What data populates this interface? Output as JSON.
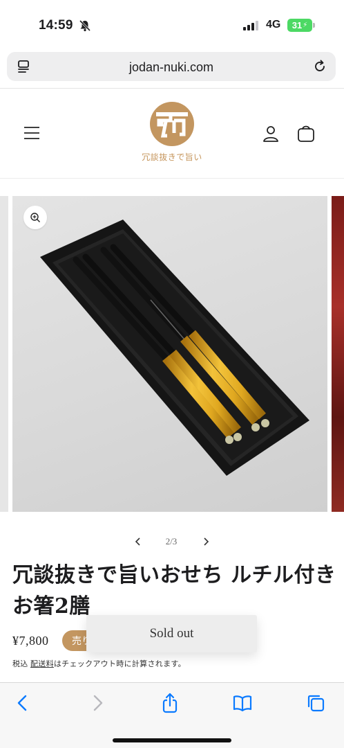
{
  "status_bar": {
    "time": "14:59",
    "network": "4G",
    "battery": "31"
  },
  "browser": {
    "url": "jodan-nuki.com"
  },
  "site": {
    "logo_text": "冗談抜きで旨い",
    "brand_color": "#c39660"
  },
  "gallery": {
    "counter": "2/3"
  },
  "product": {
    "title": "冗談抜きで旨いおせち ルチル付きお箸2膳",
    "price": "¥7,800",
    "badge": "売り",
    "sold_out_toast": "Sold out",
    "tax_prefix": "税込",
    "tax_link": "配送料",
    "tax_suffix": "はチェックアウト時に計算されます。"
  },
  "icons": {
    "menu": "hamburger-icon",
    "account": "person-icon",
    "cart": "bag-icon",
    "zoom": "zoom-in-icon",
    "back": "chevron-left-icon",
    "forward": "chevron-right-icon",
    "share": "share-icon",
    "bookmarks": "book-icon",
    "tabs": "tabs-icon"
  },
  "colors": {
    "ios_blue": "#0a7aff",
    "battery_green": "#4cd964"
  }
}
